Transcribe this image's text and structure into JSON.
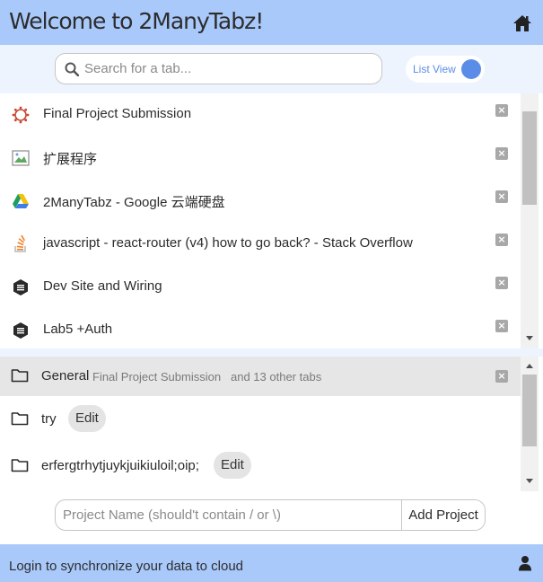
{
  "header": {
    "title": "Welcome to 2ManyTabz!",
    "home_icon": "home-icon"
  },
  "search": {
    "placeholder": "Search for a tab...",
    "value": "",
    "icon": "search-icon"
  },
  "view_toggle": {
    "label": "List View",
    "on": true,
    "accent": "#5b8de8"
  },
  "tabs": [
    {
      "title": "Final Project Submission",
      "icon": "canvas-logo-icon"
    },
    {
      "title": "扩展程序",
      "icon": "broken-image-icon"
    },
    {
      "title": "2ManyTabz - Google 云端硬盘",
      "icon": "google-drive-icon"
    },
    {
      "title": "javascript - react-router (v4) how to go back? - Stack Overflow",
      "icon": "stack-overflow-icon"
    },
    {
      "title": "Dev Site and Wiring",
      "icon": "hexagon-doc-icon"
    },
    {
      "title": "Lab5 +Auth",
      "icon": "hexagon-doc-icon"
    }
  ],
  "projects": [
    {
      "name": "General",
      "sub_first": "Final Project Submission",
      "sub_rest": "and 13 other tabs",
      "active": true
    },
    {
      "name": "try",
      "edit_label": "Edit"
    },
    {
      "name": "erfergtrhytjuykjuikiuloil;oip;",
      "edit_label": "Edit"
    }
  ],
  "add_project": {
    "placeholder": "Project Name (should't contain / or \\)",
    "value": "",
    "button_label": "Add Project"
  },
  "footer": {
    "text": "Login to synchronize your data to cloud",
    "icon": "user-icon"
  },
  "colors": {
    "header_bg": "#a9c9fb",
    "accent": "#5b8de8",
    "panel_bg": "#eef4fe"
  }
}
